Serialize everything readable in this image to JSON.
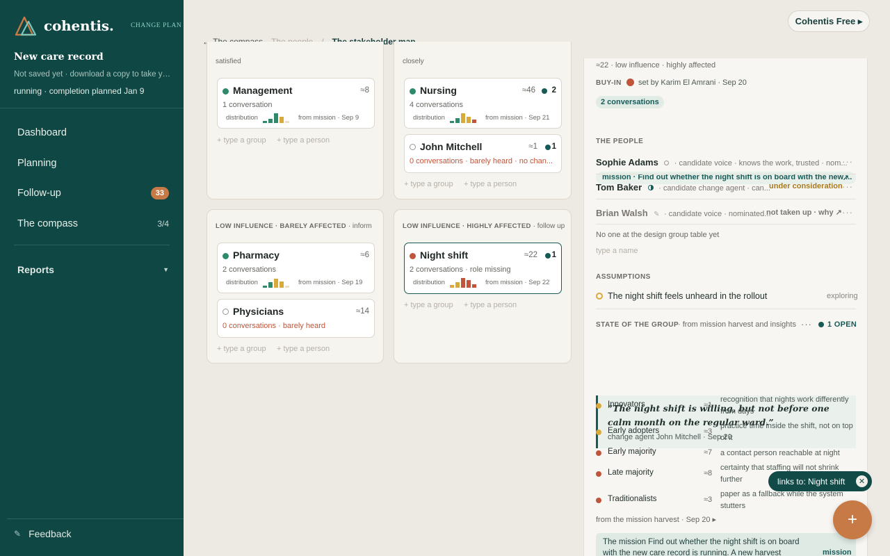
{
  "sidebar": {
    "brand": "cohentis.",
    "change_plan": "CHANGE PLAN",
    "record_title": "New care record",
    "record_sub": "Not saved yet · download a copy to take your ...",
    "record_status": "running · completion planned Jan 9",
    "nav": [
      {
        "label": "Dashboard"
      },
      {
        "label": "Planning"
      },
      {
        "label": "Follow-up",
        "badge": "33"
      },
      {
        "label": "The compass",
        "count": "3/4"
      }
    ],
    "reports": "Reports",
    "feedback": "Feedback"
  },
  "topbar": {
    "plan_button": "Cohentis Free ▸"
  },
  "breadcrumb": {
    "back": "← The compass",
    "middle": "The people",
    "sep": "/",
    "current": "The stakeholder map"
  },
  "board": {
    "top_left": {
      "label_tail": "satisfied",
      "cards": [
        {
          "title": "Management",
          "approx": "≈8",
          "sub": "1 conversation",
          "dist": "distribution",
          "from": "from mission · Sep 9"
        }
      ],
      "add_group": "+ type a group",
      "add_person": "+ type a person"
    },
    "top_right": {
      "label_tail": "closely",
      "cards": [
        {
          "title": "Nursing",
          "approx": "≈46",
          "count": "2",
          "sub": "4 conversations",
          "dist": "distribution",
          "from": "from mission · Sep 21"
        },
        {
          "title": "John Mitchell",
          "approx": "≈1",
          "count": "1",
          "sub": "0 conversations · barely heard   · no chan..."
        }
      ],
      "add_group": "+ type a group",
      "add_person": "+ type a person"
    },
    "bottom_left": {
      "label": "LOW INFLUENCE · BARELY AFFECTED",
      "action": "· inform",
      "cards": [
        {
          "title": "Pharmacy",
          "approx": "≈6",
          "sub": "2 conversations",
          "dist": "distribution",
          "from": "from mission · Sep 19"
        },
        {
          "title": "Physicians",
          "approx": "≈14",
          "sub": "0 conversations · barely heard"
        }
      ],
      "add_group": "+ type a group",
      "add_person": "+ type a person"
    },
    "bottom_right": {
      "label": "LOW INFLUENCE · HIGHLY AFFECTED",
      "action": "· follow up",
      "cards": [
        {
          "title": "Night shift",
          "approx": "≈22",
          "count": "1",
          "sub": "2 conversations   · role missing",
          "dist": "distribution",
          "from": "from mission · Sep 22"
        }
      ],
      "add_group": "+ type a group",
      "add_person": "+ type a person"
    }
  },
  "panel": {
    "summary": "≈22 · low influence · highly affected",
    "buyin_label": "BUY-IN",
    "buyin_text": "set by Karim El Amrani · Sep 20",
    "conversations_tag": "2 conversations",
    "mission_text": "mission · Find out whether the night shift is on board with the new ...",
    "mission_arrow": "↗",
    "people_header": "THE PEOPLE",
    "people": [
      {
        "name": "Sophie Adams",
        "desc": "· candidate voice · knows the work, trusted · nom...",
        "status": "",
        "more": "···"
      },
      {
        "name": "Tom Baker",
        "desc": "· candidate change agent · can...",
        "status": "under consideration",
        "more": "···"
      },
      {
        "name": "Brian Walsh",
        "desc": "· candidate voice · nominated...",
        "status": "not taken up · why ↗",
        "more": "···"
      }
    ],
    "design_note": "No one at the design group table yet",
    "name_placeholder": "type a name",
    "assumptions_header": "ASSUMPTIONS",
    "assumption": "The night shift feels unheard in the rollout",
    "assumption_status": "exploring",
    "state_header": "STATE OF THE GROUP",
    "state_source": "· from mission harvest and insights",
    "state_more": "···",
    "open_count": "1 OPEN",
    "quote": "“The night shift is willing, but not before one calm month on the regular ward.”",
    "quote_by": "change agent John Mitchell · Sep 20",
    "segments": [
      {
        "name": "Innovators",
        "n": "≈1",
        "note": "recognition that nights work differently from days",
        "color": "#d8a93b"
      },
      {
        "name": "Early adopters",
        "n": "≈3",
        "note": "practice time inside the shift, not on top of it",
        "color": "#d8a93b"
      },
      {
        "name": "Early majority",
        "n": "≈7",
        "note": "a contact person reachable at night",
        "color": "#c0553b"
      },
      {
        "name": "Late majority",
        "n": "≈8",
        "note": "certainty that staffing will not shrink further",
        "color": "#c0553b"
      },
      {
        "name": "Traditionalists",
        "n": "≈3",
        "note": "paper as a fallback while the system stutters",
        "color": "#c0553b"
      }
    ],
    "harvest_link": "from the mission harvest · Sep 20 ▸",
    "bottom_text": "The mission Find out whether the night shift is on board with the new care record is running. A new harvest",
    "bottom_link": "mission ↗"
  },
  "toast": {
    "text": "links to: Night shift",
    "close": "✕"
  },
  "fab": {
    "label": "+"
  },
  "colors": {
    "sidebar": "#0f4745",
    "accent": "#c77a45",
    "green": "#2e8a6a",
    "amber": "#d8a93b",
    "red": "#c0553b"
  }
}
